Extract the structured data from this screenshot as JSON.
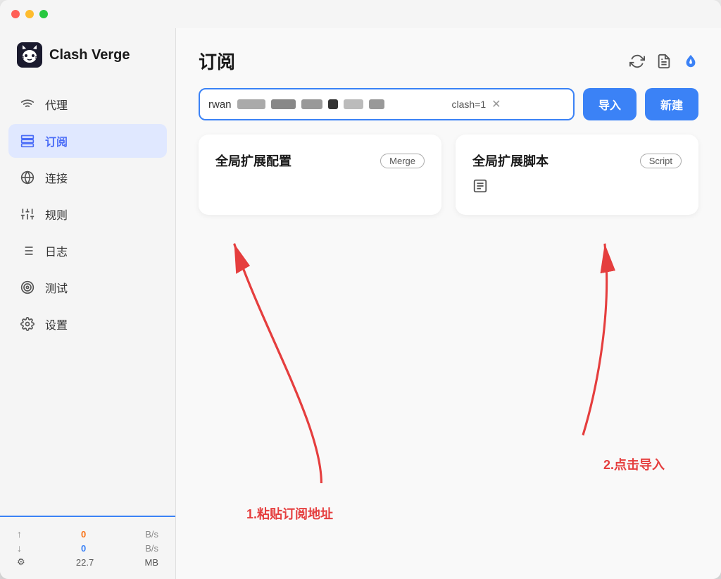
{
  "window": {
    "title": "Clash Verge"
  },
  "sidebar": {
    "logo": {
      "text": "Clash Verge"
    },
    "nav_items": [
      {
        "id": "proxy",
        "label": "代理",
        "icon": "wifi",
        "active": false
      },
      {
        "id": "subscribe",
        "label": "订阅",
        "icon": "layers",
        "active": true
      },
      {
        "id": "connection",
        "label": "连接",
        "icon": "globe",
        "active": false
      },
      {
        "id": "rules",
        "label": "规则",
        "icon": "sliders",
        "active": false
      },
      {
        "id": "logs",
        "label": "日志",
        "icon": "list",
        "active": false
      },
      {
        "id": "test",
        "label": "测试",
        "icon": "target",
        "active": false
      },
      {
        "id": "settings",
        "label": "设置",
        "icon": "gear",
        "active": false
      }
    ],
    "footer": {
      "upload_speed": "0",
      "download_speed": "0",
      "speed_unit": "B/s",
      "memory": "22.7",
      "memory_unit": "MB"
    }
  },
  "main": {
    "page_title": "订阅",
    "url_input_prefix": "rwan",
    "url_input_suffix": "clash=1",
    "import_btn_label": "导入",
    "new_btn_label": "新建",
    "cards": [
      {
        "id": "global-extend-config",
        "title": "全局扩展配置",
        "badge": "Merge",
        "icon": null
      },
      {
        "id": "global-extend-script",
        "title": "全局扩展脚本",
        "badge": "Script",
        "icon": "file"
      }
    ],
    "annotations": {
      "step1": "1.粘贴订阅地址",
      "step2": "2.点击导入"
    }
  }
}
